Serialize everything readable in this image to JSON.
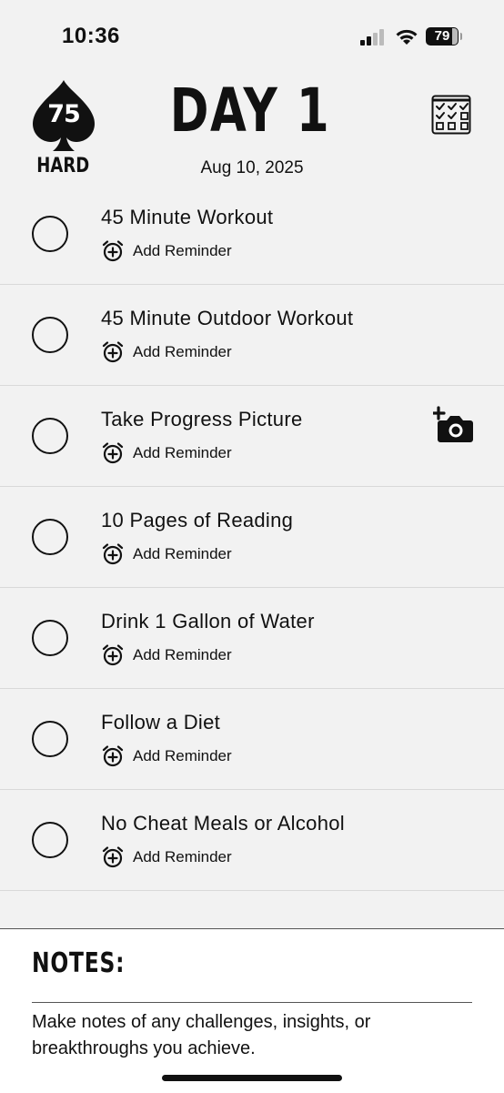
{
  "status_bar": {
    "time": "10:36",
    "battery": "79"
  },
  "header": {
    "logo_number": "75",
    "logo_word": "HARD",
    "title": "DAY 1",
    "date": "Aug 10, 2025"
  },
  "tasks": [
    {
      "title": "45 Minute Workout",
      "reminder_label": "Add Reminder",
      "completed": false
    },
    {
      "title": "45 Minute Outdoor Workout",
      "reminder_label": "Add Reminder",
      "completed": false
    },
    {
      "title": "Take Progress Picture",
      "reminder_label": "Add Reminder",
      "completed": false,
      "action_icon": "add-photo-icon"
    },
    {
      "title": "10 Pages of Reading",
      "reminder_label": "Add Reminder",
      "completed": false
    },
    {
      "title": "Drink 1 Gallon of Water",
      "reminder_label": "Add Reminder",
      "completed": false
    },
    {
      "title": "Follow a Diet",
      "reminder_label": "Add Reminder",
      "completed": false
    },
    {
      "title": "No Cheat Meals or Alcohol",
      "reminder_label": "Add Reminder",
      "completed": false
    }
  ],
  "notes": {
    "title": "NOTES:",
    "placeholder": "Make notes of any challenges, insights, or breakthroughs you achieve."
  },
  "icons": {
    "logo": "spade-logo",
    "calendar": "calendar-checklist-icon",
    "reminder": "alarm-add-icon",
    "photo": "camera-add-icon"
  }
}
